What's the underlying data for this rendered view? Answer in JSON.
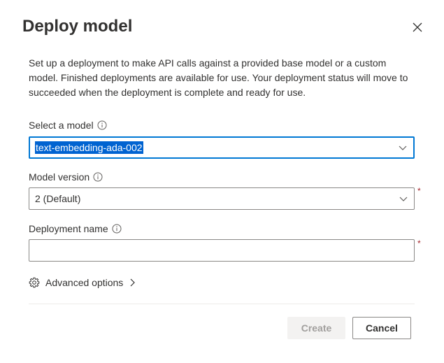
{
  "dialog": {
    "title": "Deploy model",
    "description": "Set up a deployment to make API calls against a provided base model or a custom model. Finished deployments are available for use. Your deployment status will move to succeeded when the deployment is complete and ready for use."
  },
  "fields": {
    "model": {
      "label": "Select a model",
      "value": "text-embedding-ada-002"
    },
    "version": {
      "label": "Model version",
      "value": "2 (Default)",
      "required_mark": "*"
    },
    "deployment_name": {
      "label": "Deployment name",
      "value": "",
      "placeholder": "",
      "required_mark": "*"
    }
  },
  "advanced": {
    "label": "Advanced options"
  },
  "footer": {
    "create_label": "Create",
    "cancel_label": "Cancel"
  },
  "icons": {
    "close": "close-icon",
    "info": "info-icon",
    "chevron_down": "chevron-down-icon",
    "gear": "gear-icon",
    "chevron_right": "chevron-right-icon"
  },
  "colors": {
    "accent": "#0078d4",
    "selection": "#0063d1",
    "required": "#a4262c",
    "disabled_bg": "#f3f2f1",
    "disabled_text": "#a19f9d"
  }
}
